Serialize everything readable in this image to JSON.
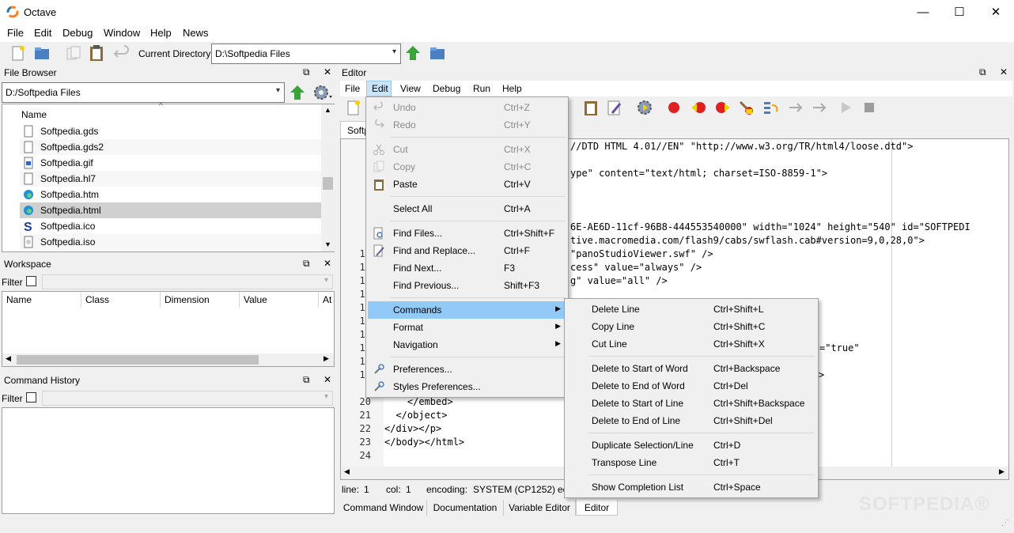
{
  "window": {
    "title": "Octave",
    "minimize": "—",
    "maximize": "☐",
    "close": "✕"
  },
  "menubar": [
    "File",
    "Edit",
    "Debug",
    "Window",
    "Help",
    "News"
  ],
  "toolbar": {
    "current_dir_label": "Current Directory:",
    "current_dir_value": "D:\\Softpedia Files"
  },
  "file_browser": {
    "title": "File Browser",
    "path": "D:/Softpedia Files",
    "column_name": "Name",
    "files": [
      {
        "name": "Softpedia.gds",
        "icon": "document-icon"
      },
      {
        "name": "Softpedia.gds2",
        "icon": "document-icon"
      },
      {
        "name": "Softpedia.gif",
        "icon": "image-icon"
      },
      {
        "name": "Softpedia.hl7",
        "icon": "document-icon"
      },
      {
        "name": "Softpedia.htm",
        "icon": "edge-icon"
      },
      {
        "name": "Softpedia.html",
        "icon": "edge-icon"
      },
      {
        "name": "Softpedia.ico",
        "icon": "softpedia-s-icon"
      },
      {
        "name": "Softpedia.iso",
        "icon": "disc-icon"
      }
    ],
    "selected_index": 5
  },
  "workspace": {
    "title": "Workspace",
    "filter_label": "Filter",
    "columns": [
      "Name",
      "Class",
      "Dimension",
      "Value",
      "At"
    ]
  },
  "command_history": {
    "title": "Command History",
    "filter_label": "Filter"
  },
  "editor": {
    "title": "Editor",
    "menu": [
      "File",
      "Edit",
      "View",
      "Debug",
      "Run",
      "Help"
    ],
    "tab_label": "Softp",
    "code_fragments": [
      {
        "ln": "",
        "text": "//DTD HTML 4.01//EN\" \"http://www.w3.org/TR/html4/loose.dtd\">"
      },
      {
        "ln": "",
        "text": ""
      },
      {
        "ln": "",
        "text": "ype\" content=\"text/html; charset=ISO-8859-1\">"
      },
      {
        "ln": "",
        "text": ""
      },
      {
        "ln": "",
        "text": ""
      },
      {
        "ln": "",
        "text": ""
      },
      {
        "ln": "",
        "text": "6E-AE6D-11cf-96B8-444553540000\" width=\"1024\" height=\"540\" id=\"SOFTPEDI"
      },
      {
        "ln": "",
        "text": "tive.macromedia.com/flash9/cabs/swflash.cab#version=9,0,28,0\">"
      },
      {
        "ln": "10",
        "text": "\"panoStudioViewer.swf\" />"
      },
      {
        "ln": "11",
        "text": "cess\" value=\"always\" />"
      },
      {
        "ln": "12",
        "text": "g\" value=\"all\" />"
      },
      {
        "ln": "13",
        "text": ""
      },
      {
        "ln": "14",
        "text": ""
      },
      {
        "ln": "15",
        "text": ""
      },
      {
        "ln": "16",
        "text": ""
      },
      {
        "ln": "17",
        "text": "=\"true\""
      },
      {
        "ln": "18",
        "text": ""
      },
      {
        "ln": "19",
        "text": ">"
      }
    ],
    "code_tail": [
      {
        "ln": "20",
        "text": "    </embed>"
      },
      {
        "ln": "21",
        "text": "  </object>"
      },
      {
        "ln": "22",
        "text": "</div></p>"
      },
      {
        "ln": "23",
        "text": "</body></html>"
      },
      {
        "ln": "24",
        "text": ""
      }
    ],
    "status": {
      "line_label": "line:",
      "line_value": "1",
      "col_label": "col:",
      "col_value": "1",
      "encoding_label": "encoding:",
      "encoding_value": "SYSTEM (CP1252)",
      "eol_label": "eo"
    }
  },
  "bottom_tabs": [
    "Command Window",
    "Documentation",
    "Variable Editor",
    "Editor"
  ],
  "edit_menu": [
    {
      "label": "Undo",
      "shortcut": "Ctrl+Z",
      "disabled": true,
      "icon": "undo-icon"
    },
    {
      "label": "Redo",
      "shortcut": "Ctrl+Y",
      "disabled": true,
      "icon": "redo-icon"
    },
    {
      "label": "Cut",
      "shortcut": "Ctrl+X",
      "disabled": true,
      "icon": "cut-icon"
    },
    {
      "label": "Copy",
      "shortcut": "Ctrl+C",
      "disabled": true,
      "icon": "copy-icon"
    },
    {
      "label": "Paste",
      "shortcut": "Ctrl+V",
      "disabled": false,
      "icon": "paste-icon"
    },
    {
      "label": "Select All",
      "shortcut": "Ctrl+A",
      "disabled": false,
      "icon": ""
    },
    {
      "label": "Find Files...",
      "shortcut": "Ctrl+Shift+F",
      "disabled": false,
      "icon": "find-files-icon"
    },
    {
      "label": "Find and Replace...",
      "shortcut": "Ctrl+F",
      "disabled": false,
      "icon": "find-replace-icon"
    },
    {
      "label": "Find Next...",
      "shortcut": "F3",
      "disabled": false,
      "icon": ""
    },
    {
      "label": "Find Previous...",
      "shortcut": "Shift+F3",
      "disabled": false,
      "icon": ""
    },
    {
      "label": "Commands",
      "shortcut": "",
      "disabled": false,
      "icon": "",
      "submenu": true
    },
    {
      "label": "Format",
      "shortcut": "",
      "disabled": false,
      "icon": "",
      "submenu": true
    },
    {
      "label": "Navigation",
      "shortcut": "",
      "disabled": false,
      "icon": "",
      "submenu": true
    },
    {
      "label": "Preferences...",
      "shortcut": "",
      "disabled": false,
      "icon": "preferences-icon"
    },
    {
      "label": "Styles Preferences...",
      "shortcut": "",
      "disabled": false,
      "icon": "styles-preferences-icon"
    }
  ],
  "commands_submenu": [
    {
      "label": "Delete Line",
      "shortcut": "Ctrl+Shift+L"
    },
    {
      "label": "Copy Line",
      "shortcut": "Ctrl+Shift+C"
    },
    {
      "label": "Cut Line",
      "shortcut": "Ctrl+Shift+X"
    },
    {
      "label": "Delete to Start of Word",
      "shortcut": "Ctrl+Backspace"
    },
    {
      "label": "Delete to End of Word",
      "shortcut": "Ctrl+Del"
    },
    {
      "label": "Delete to Start of Line",
      "shortcut": "Ctrl+Shift+Backspace"
    },
    {
      "label": "Delete to End of Line",
      "shortcut": "Ctrl+Shift+Del"
    },
    {
      "label": "Duplicate Selection/Line",
      "shortcut": "Ctrl+D"
    },
    {
      "label": "Transpose Line",
      "shortcut": "Ctrl+T"
    },
    {
      "label": "Show Completion List",
      "shortcut": "Ctrl+Space"
    }
  ],
  "watermark": "SOFTPEDIA®",
  "colors": {
    "accent_highlight": "#91c9f7",
    "selection_gray": "#d0d0d0",
    "run_green": "#3ca23c",
    "folder_blue": "#4a7fc1",
    "breakpoint_red": "#e02020"
  }
}
